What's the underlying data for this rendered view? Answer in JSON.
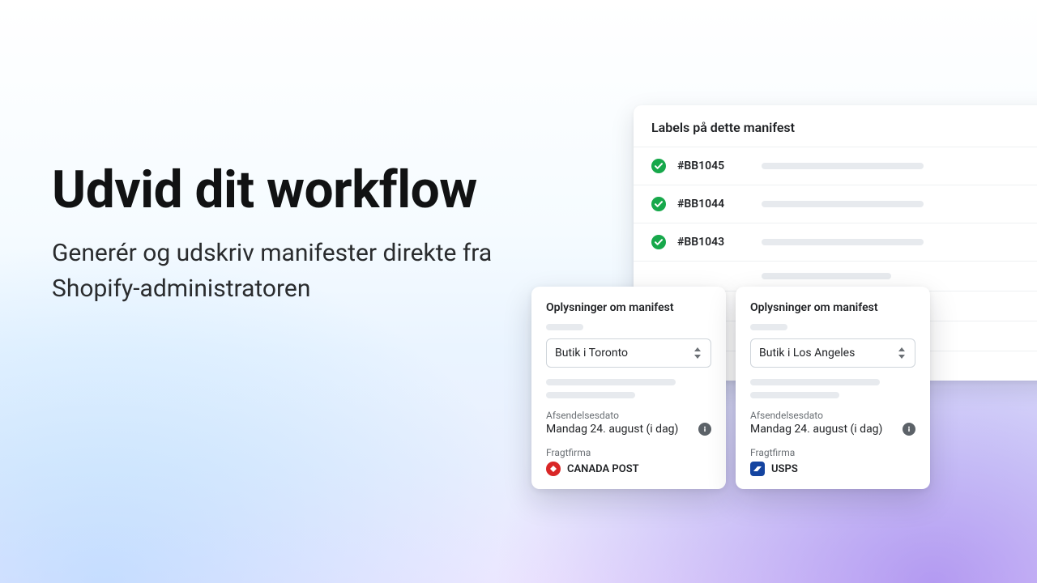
{
  "copy": {
    "headline": "Udvid dit workflow",
    "subhead": "Generér og udskriv manifester direkte fra Shopify-administratoren"
  },
  "labels_panel": {
    "title": "Labels på dette manifest",
    "rows": [
      {
        "id": "#BB1045"
      },
      {
        "id": "#BB1044"
      },
      {
        "id": "#BB1043"
      }
    ]
  },
  "card_common": {
    "title": "Oplysninger om manifest",
    "date_label": "Afsendelsesdato",
    "date_value": "Mandag 24. august (i dag)",
    "carrier_label": "Fragtfirma"
  },
  "card_left": {
    "select_value": "Butik i Toronto",
    "carrier_name": "CANADA POST"
  },
  "card_right": {
    "select_value": "Butik i Los Angeles",
    "carrier_name": "USPS"
  }
}
